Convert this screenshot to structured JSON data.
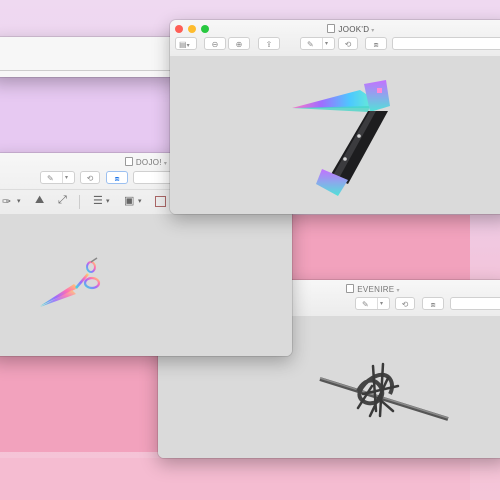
{
  "windows": {
    "jookd": {
      "title": "JOOK'D"
    },
    "dojo": {
      "title": "DOJO!"
    },
    "evenire": {
      "title": "EVENIRE"
    }
  },
  "toolbar": {
    "zoom_out_icon": "zoom-out-icon",
    "zoom_in_icon": "zoom-in-icon",
    "share_icon": "share-icon",
    "markup_icon": "pen-icon",
    "rotate_icon": "rotate-icon",
    "toolbox_icon": "toolbox-icon",
    "sidebar_icon": "sidebar-icon"
  },
  "colors": {
    "close": "#fe5f57",
    "minimize": "#febc2e",
    "zoom": "#28c840",
    "toolbox_active": "#1a73e8"
  }
}
